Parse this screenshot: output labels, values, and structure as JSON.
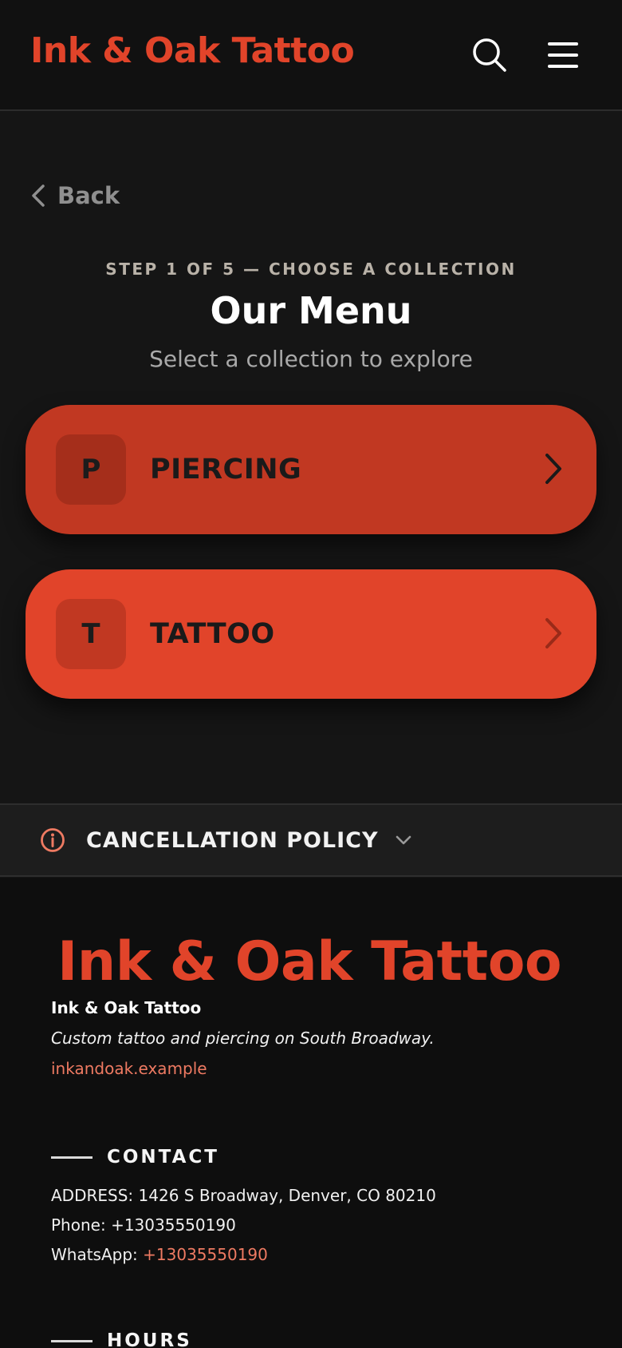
{
  "header": {
    "brand": "Ink & Oak Tattoo",
    "search_icon": "search-icon",
    "menu_icon": "hamburger-menu-icon"
  },
  "nav": {
    "back_label": "Back"
  },
  "main": {
    "step": "STEP 1 OF 5 — CHOOSE A COLLECTION",
    "title": "Our Menu",
    "subtitle": "Select a collection to explore",
    "collections": [
      {
        "badge": "P",
        "label": "PIERCING",
        "color": "#c13822"
      },
      {
        "badge": "T",
        "label": "TATTOO",
        "color": "#e1442a"
      }
    ]
  },
  "policy": {
    "label": "CANCELLATION POLICY",
    "icon": "info-icon"
  },
  "footer": {
    "logo_text": "Ink & Oak Tattoo",
    "name": "Ink & Oak Tattoo",
    "tagline": "Custom tattoo and piercing on South Broadway.",
    "website": "inkandoak.example",
    "contact": {
      "heading": "CONTACT",
      "address_label": "ADDRESS:",
      "address": "1426 S Broadway, Denver, CO 80210",
      "phone_label": "Phone:",
      "phone": "+13035550190",
      "whatsapp_label": "WhatsApp:",
      "whatsapp": "+13035550190"
    },
    "hours": {
      "heading": "HOURS"
    }
  },
  "colors": {
    "accent": "#e1442a",
    "accent_dark": "#c13822",
    "background": "#151515",
    "link": "#ee7a62"
  }
}
